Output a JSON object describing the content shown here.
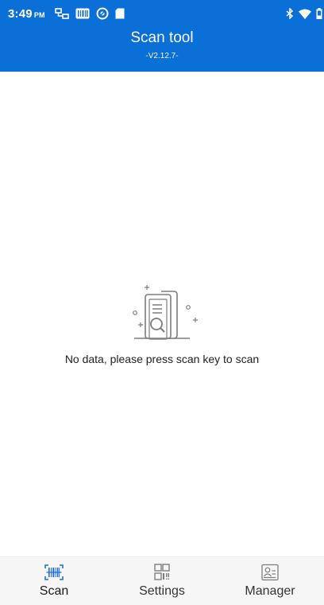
{
  "status_bar": {
    "time": "3:49",
    "ampm": "PM",
    "left_icons": [
      "network-icon",
      "barcode-status-icon",
      "sync-icon",
      "sd-card-icon"
    ],
    "right_icons": [
      "bluetooth-icon",
      "wifi-icon",
      "battery-icon"
    ]
  },
  "header": {
    "title": "Scan tool",
    "version": "-V2.12.7-",
    "color": "#0a6fd6"
  },
  "empty_state": {
    "icon": "empty-documents-search-icon",
    "message": "No data, please press scan key to scan"
  },
  "bottom_nav": {
    "active_tab": "Scan",
    "active_color": "#1f6fd6",
    "items": [
      {
        "label": "Scan",
        "icon": "barcode-scan-icon"
      },
      {
        "label": "Settings",
        "icon": "qr-code-icon"
      },
      {
        "label": "Manager",
        "icon": "contact-card-icon"
      }
    ]
  }
}
